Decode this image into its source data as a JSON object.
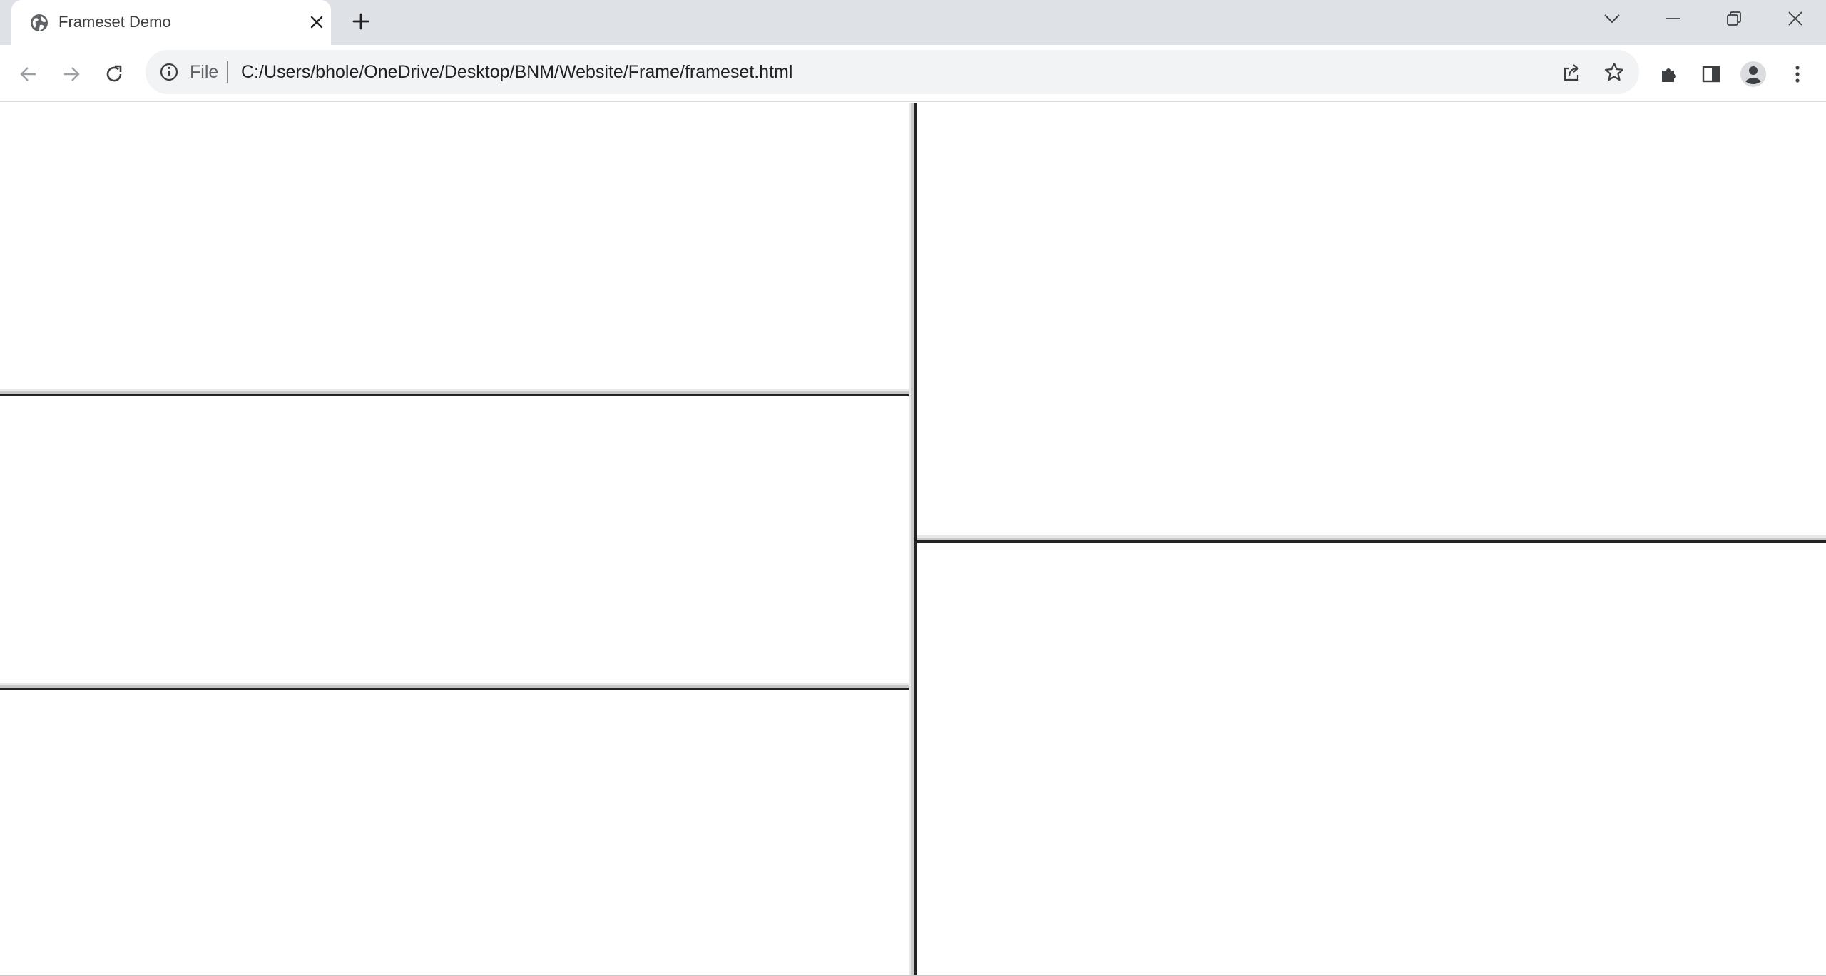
{
  "browser": {
    "tab": {
      "title": "Frameset Demo",
      "favicon": "globe-icon"
    },
    "omnibox": {
      "scheme_label": "File",
      "url": "C:/Users/bhole/OneDrive/Desktop/BNM/Website/Frame/frameset.html"
    },
    "colors": {
      "tabstrip_bg": "#dee1e6",
      "omnibox_bg": "#f1f3f4",
      "frame_border": "#c8c8c8"
    }
  },
  "frameset": {
    "left_column_frames": 3,
    "right_column_frames": 2
  }
}
